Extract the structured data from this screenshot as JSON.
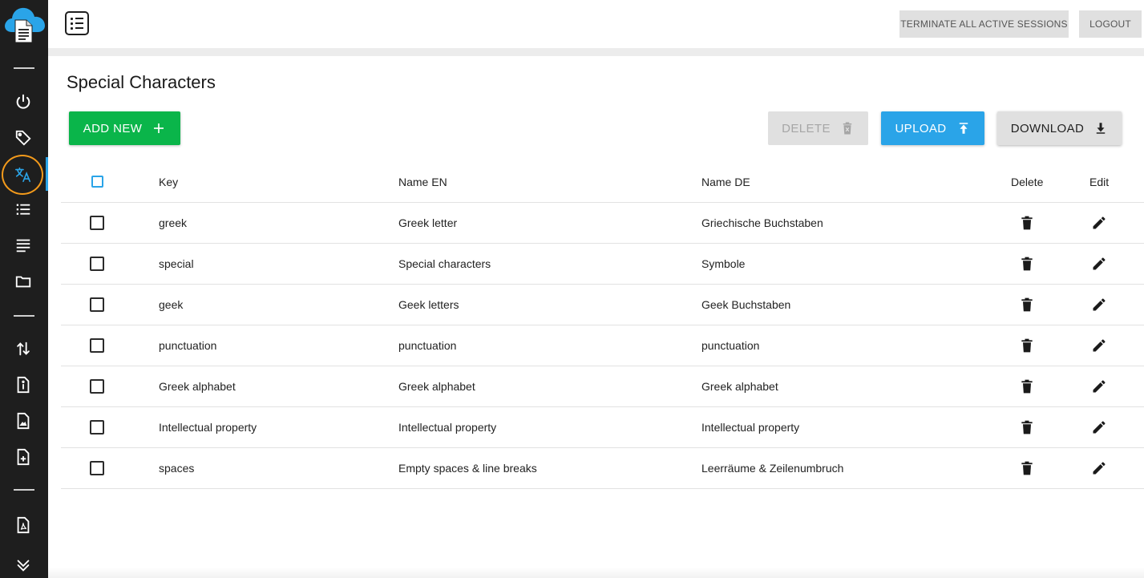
{
  "topbar": {
    "terminate_label": "TERMINATE ALL ACTIVE SESSIONS",
    "logout_label": "LOGOUT"
  },
  "sidebar": {
    "logo_icon": "cloud-document-icon",
    "items": [
      {
        "name": "power-icon"
      },
      {
        "name": "tag-icon"
      },
      {
        "name": "translate-icon",
        "active": true
      },
      {
        "name": "list-icon"
      },
      {
        "name": "text-lines-icon"
      },
      {
        "name": "folder-icon"
      },
      {
        "name": "sort-arrows-icon"
      },
      {
        "name": "file-info-icon"
      },
      {
        "name": "file-image-icon"
      },
      {
        "name": "file-add-icon"
      },
      {
        "name": "file-pdf-icon"
      },
      {
        "name": "double-chevron-down-icon"
      }
    ],
    "active_ring_color": "#f39a1b",
    "active_bar_color": "#2aa4e8"
  },
  "page": {
    "title": "Special Characters"
  },
  "actions": {
    "add_label": "ADD NEW",
    "delete_label": "DELETE",
    "upload_label": "UPLOAD",
    "download_label": "DOWNLOAD"
  },
  "colors": {
    "add": "#0ab54a",
    "upload": "#2aa4e8",
    "sidebar": "#1e1e1e"
  },
  "table": {
    "headers": {
      "key": "Key",
      "name_en": "Name EN",
      "name_de": "Name DE",
      "delete": "Delete",
      "edit": "Edit"
    },
    "rows": [
      {
        "key": "greek",
        "name_en": "Greek letter",
        "name_de": "Griechische Buchstaben"
      },
      {
        "key": "special",
        "name_en": "Special characters",
        "name_de": "Symbole"
      },
      {
        "key": "geek",
        "name_en": "Geek letters",
        "name_de": "Geek Buchstaben"
      },
      {
        "key": "punctuation",
        "name_en": "punctuation",
        "name_de": "punctuation"
      },
      {
        "key": "Greek alphabet",
        "name_en": "Greek alphabet",
        "name_de": "Greek alphabet"
      },
      {
        "key": "Intellectual property",
        "name_en": "Intellectual property",
        "name_de": "Intellectual property"
      },
      {
        "key": "spaces",
        "name_en": "Empty spaces & line breaks",
        "name_de": "Leerräume & Zeilenumbruch"
      }
    ]
  }
}
